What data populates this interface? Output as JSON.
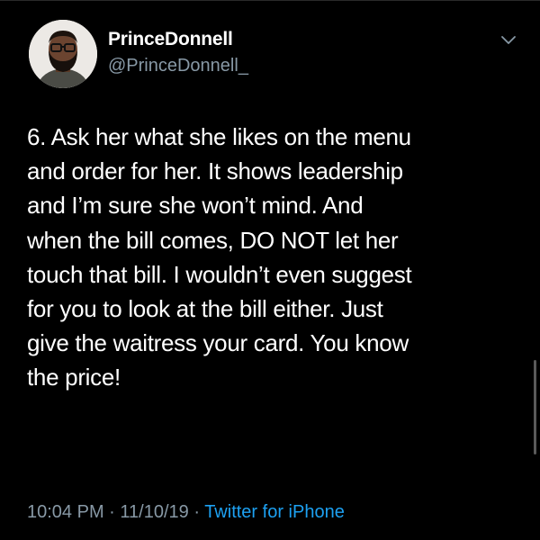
{
  "tweet": {
    "author": {
      "display_name": "PrinceDonnell",
      "handle": "@PrinceDonnell_"
    },
    "text_lines": [
      "6. Ask her what she likes on the menu",
      "and order for her. It shows leadership",
      "and I’m sure she won’t mind. And",
      "when the bill comes, DO NOT let her",
      "touch that bill. I wouldn’t even suggest",
      "for you to look at the bill either. Just",
      "give the waitress your card. You know",
      "the price!"
    ],
    "time": "10:04 PM",
    "separator": " · ",
    "date": "11/10/19",
    "source": "Twitter for iPhone"
  },
  "icons": {
    "menu": "chevron-down-icon",
    "avatar": "avatar"
  },
  "colors": {
    "background": "#000000",
    "text": "#ffffff",
    "muted": "#8899a6",
    "link": "#1da1f2"
  }
}
